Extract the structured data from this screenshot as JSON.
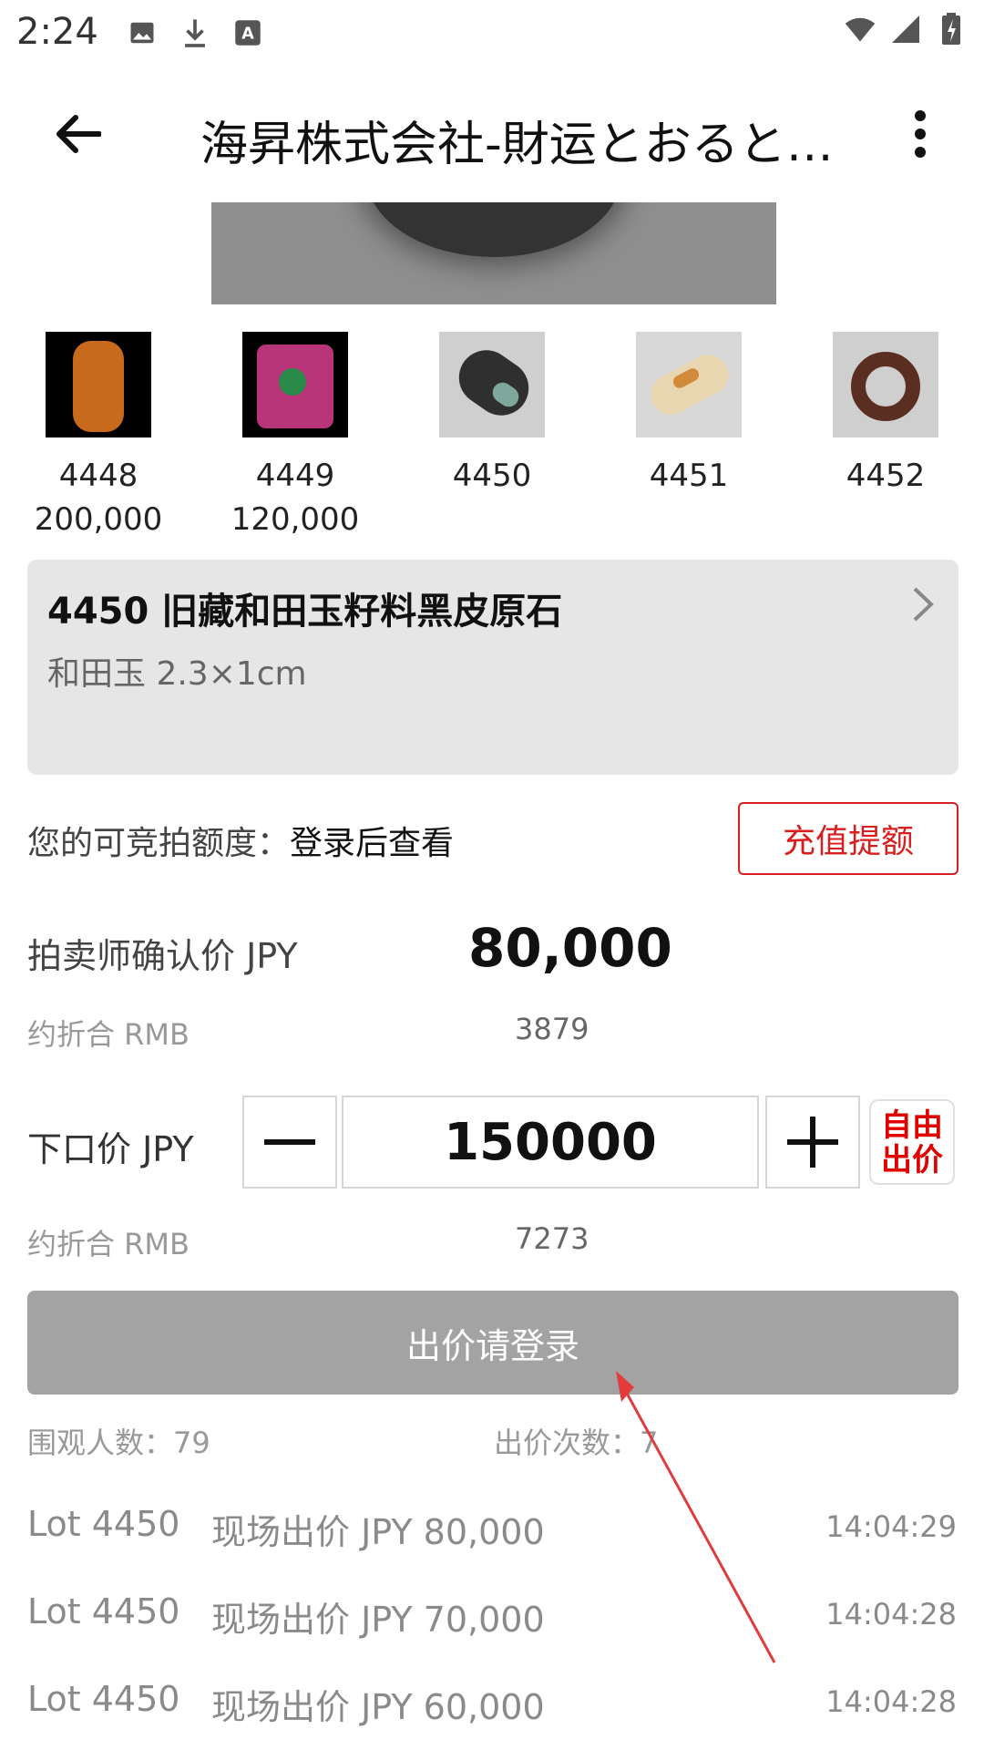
{
  "status_bar": {
    "time": "2:24",
    "left_icons": [
      "image-icon",
      "download-icon",
      "font-icon"
    ],
    "right_icons": [
      "wifi-icon",
      "signal-icon",
      "battery-icon"
    ]
  },
  "app_bar": {
    "title": "海昇株式会社-財运とおると…",
    "back_icon": "arrow-left-icon",
    "more_icon": "more-vertical-icon"
  },
  "thumbnails": [
    {
      "lot": "4448",
      "price": "200,000",
      "color": "#c76a1c"
    },
    {
      "lot": "4449",
      "price": "120,000",
      "color": "#b8357a"
    },
    {
      "lot": "4450",
      "price": "",
      "color": "#2f2f2f"
    },
    {
      "lot": "4451",
      "price": "",
      "color": "#e8d6b0"
    },
    {
      "lot": "4452",
      "price": "",
      "color": "#5a2f22"
    }
  ],
  "lot_card": {
    "title": "4450 旧藏和田玉籽料黑皮原石",
    "subtitle": "和田玉 2.3×1cm"
  },
  "quota": {
    "label": "您的可竞拍额度：",
    "value": "登录后查看",
    "button": "充值提额"
  },
  "confirm_price": {
    "label": "拍卖师确认价 JPY",
    "value": "80,000",
    "rmb_label": "约折合 RMB",
    "rmb_value": "3879"
  },
  "bid": {
    "label": "下口价 JPY",
    "value": "150000",
    "free_bid_line1": "自由",
    "free_bid_line2": "出价",
    "rmb_label": "约折合 RMB",
    "rmb_value": "7273"
  },
  "login_button": "出价请登录",
  "stats": {
    "viewers_label": "围观人数：",
    "viewers": "79",
    "bids_label": "出价次数：",
    "bids": "7"
  },
  "history": [
    {
      "lot": "Lot 4450",
      "desc": "现场出价 JPY 80,000",
      "time": "14:04:29"
    },
    {
      "lot": "Lot 4450",
      "desc": "现场出价 JPY 70,000",
      "time": "14:04:28"
    },
    {
      "lot": "Lot 4450",
      "desc": "现场出价 JPY 60,000",
      "time": "14:04:28"
    }
  ],
  "colors": {
    "accent_red": "#d81e1e",
    "disabled_button": "#a3a3a3",
    "card_bg": "#e6e6e6"
  }
}
